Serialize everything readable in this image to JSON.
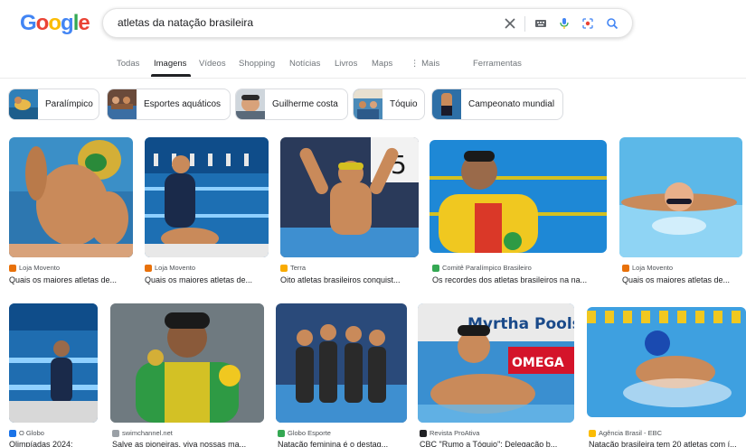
{
  "logo": {
    "letters": [
      "G",
      "o",
      "o",
      "g",
      "l",
      "e"
    ],
    "colors": [
      "#4285F4",
      "#EA4335",
      "#FBBC05",
      "#4285F4",
      "#34A853",
      "#EA4335"
    ]
  },
  "search": {
    "value": "atletas da natação brasileira",
    "icons": [
      "close-icon",
      "keyboard-icon",
      "microphone-icon",
      "lens-icon",
      "search-icon"
    ]
  },
  "tabs": [
    {
      "label": "Todas",
      "active": false
    },
    {
      "label": "Imagens",
      "active": true
    },
    {
      "label": "Vídeos",
      "active": false
    },
    {
      "label": "Shopping",
      "active": false
    },
    {
      "label": "Notícias",
      "active": false
    },
    {
      "label": "Livros",
      "active": false
    },
    {
      "label": "Maps",
      "active": false
    },
    {
      "label": "⋮ Mais",
      "active": false
    },
    {
      "label": "Ferramentas",
      "active": false
    }
  ],
  "chips": [
    {
      "label": "Paralímpico"
    },
    {
      "label": "Esportes aquáticos"
    },
    {
      "label": "Guilherme costa"
    },
    {
      "label": "Tóquio"
    },
    {
      "label": "Campeonato mundial"
    }
  ],
  "results": [
    {
      "source": "Loja Movento",
      "title": "Quais os maiores atletas de...",
      "favicon_color": "#e8710a"
    },
    {
      "source": "Loja Movento",
      "title": "Quais os maiores atletas de...",
      "favicon_color": "#e8710a"
    },
    {
      "source": "Terra",
      "title": "Oito atletas brasileiros conquist...",
      "favicon_color": "#f9ab00"
    },
    {
      "source": "Comitê Paralímpico Brasileiro",
      "title": "Os recordes dos atletas brasileiros na na...",
      "favicon_color": "#34a853"
    },
    {
      "source": "Loja Movento",
      "title": "Quais os maiores atletas de...",
      "favicon_color": "#e8710a"
    },
    {
      "source": "O Globo",
      "title": "Olimpíadas 2024:",
      "favicon_color": "#1a73e8"
    },
    {
      "source": "swimchannel.net",
      "title": "Salve as pioneiras, viva nossas ma...",
      "favicon_color": "#9aa0a6"
    },
    {
      "source": "Globo Esporte",
      "title": "Natação feminina é o destaq...",
      "favicon_color": "#34a853"
    },
    {
      "source": "Revista ProAtiva",
      "title": "CBC \"Rumo a Tóquio\": Delegação b...",
      "favicon_color": "#202124"
    },
    {
      "source": "Agência Brasil - EBC",
      "title": "Natação brasileira tem 20 atletas com í...",
      "favicon_color": "#fbbc05"
    }
  ],
  "image_texts": {
    "pools": "Myrtha Pools",
    "omega": "OMEGA"
  }
}
